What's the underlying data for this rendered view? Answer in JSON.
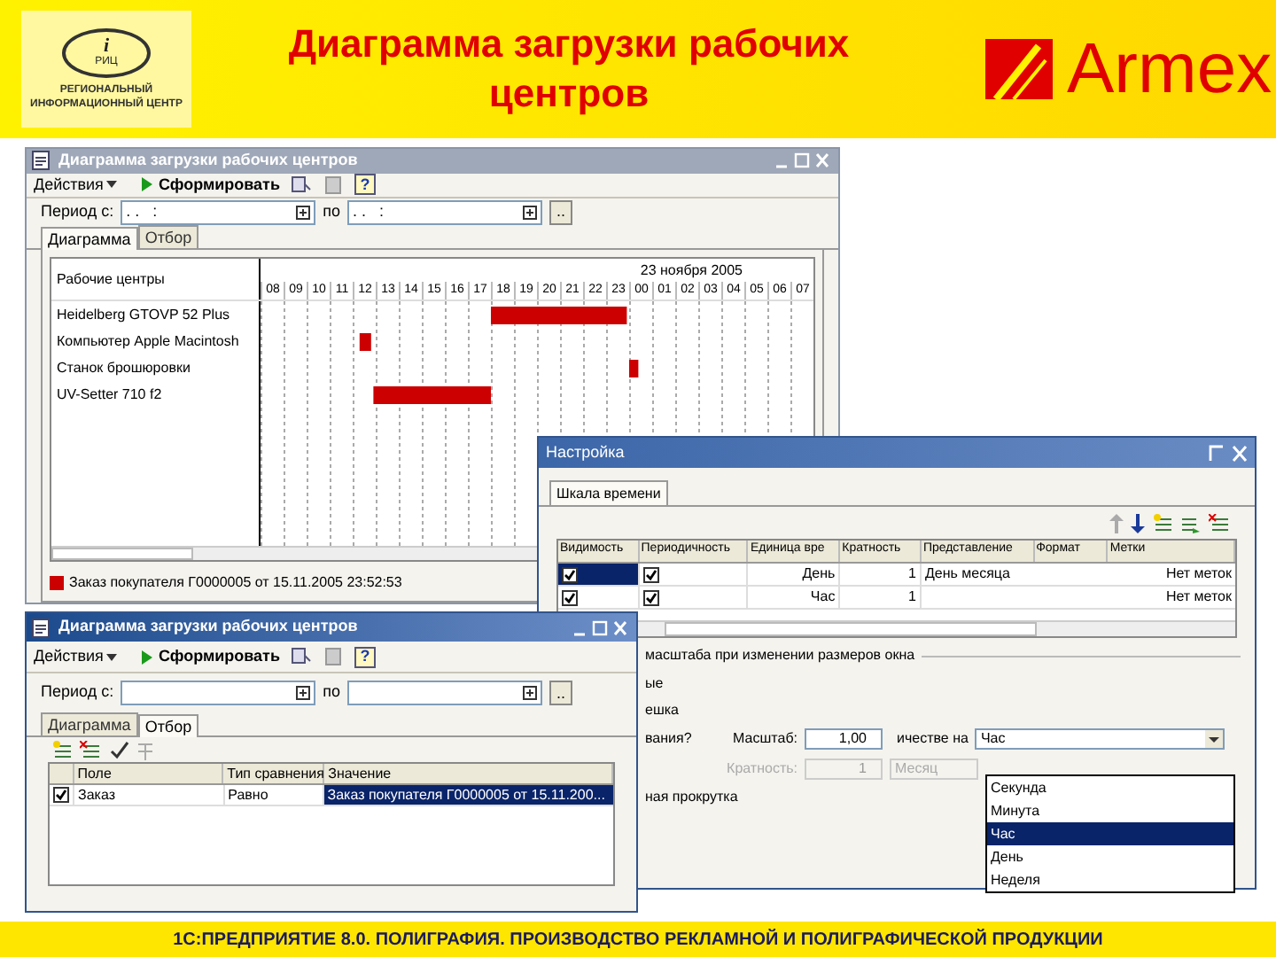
{
  "slide": {
    "logo": {
      "letter": "i",
      "abbr": "РИЦ",
      "caption": "РЕГИОНАЛЬНЫЙ ИНФОРМАЦИОННЫЙ ЦЕНТР"
    },
    "title": "Диаграмма загрузки рабочих центров",
    "brand": "Armex",
    "footer": "1С:ПРЕДПРИЯТИЕ 8.0. ПОЛИГРАФИЯ. ПРОИЗВОДСТВО РЕКЛАМНОЙ И ПОЛИГРАФИЧЕСКОЙ ПРОДУКЦИИ"
  },
  "report_window": {
    "title": "Диаграмма загрузки рабочих центров",
    "actions": "Действия",
    "generate": "Сформировать",
    "help": "?",
    "period_label": "Период с:",
    "period_from": ". .   :",
    "to_label": "по",
    "period_to": ". .   :",
    "more": "..",
    "tabs": [
      {
        "label": "Диаграмма",
        "selected": true
      },
      {
        "label": "Отбор",
        "selected": false
      }
    ],
    "gantt": {
      "header": "Рабочие центры",
      "date": "23 ноября 2005",
      "work_centers": [
        "Heidelberg GTOVP 52 Plus",
        "Компьютер Apple Macintosh",
        "Станок брошюровки",
        "UV-Setter 710 f2"
      ],
      "hours": [
        "08",
        "09",
        "10",
        "11",
        "12",
        "13",
        "14",
        "15",
        "16",
        "17",
        "18",
        "19",
        "20",
        "21",
        "22",
        "23",
        "00",
        "01",
        "02",
        "03",
        "04",
        "05",
        "06",
        "07"
      ],
      "legend": "Заказ покупателя Г0000005 от 15.11.2005 23:52:53"
    }
  },
  "settings_window": {
    "title": "Настройка",
    "tab": "Шкала времени",
    "columns": [
      "Видимость",
      "Периодичность",
      "Единица вре",
      "Кратность",
      "Представление",
      "Формат",
      "Метки"
    ],
    "rows": [
      {
        "visible": true,
        "periodic": true,
        "unit": "День",
        "multiplicity": "1",
        "presentation": "День месяца",
        "marks": "Нет меток",
        "selected": true
      },
      {
        "visible": true,
        "periodic": true,
        "unit": "Час",
        "multiplicity": "1",
        "presentation": "",
        "marks": "Нет меток",
        "selected": false
      }
    ],
    "group_title": "масштаба при изменении размеров окна",
    "line_1": "ые",
    "line_2": "ешка",
    "line_3": "вания?",
    "scale_label": "Масштаб:",
    "scale_value": "1,00",
    "unit_label": "ичестве на",
    "unit_value": "Час",
    "multiplicity_label": "Кратность:",
    "multiplicity_value": "1",
    "multiplicity_unit": "Месяц",
    "scroll_label": "ная прокрутка",
    "dropdown": [
      {
        "label": "Секунда",
        "selected": false
      },
      {
        "label": "Минута",
        "selected": false
      },
      {
        "label": "Час",
        "selected": true
      },
      {
        "label": "День",
        "selected": false
      },
      {
        "label": "Неделя",
        "selected": false
      }
    ]
  },
  "filter_window": {
    "title": "Диаграмма загрузки рабочих центров",
    "actions": "Действия",
    "generate": "Сформировать",
    "help": "?",
    "period_label": "Период с:",
    "to_label": "по",
    "more": "..",
    "tabs": [
      {
        "label": "Диаграмма",
        "selected": false
      },
      {
        "label": "Отбор",
        "selected": true
      }
    ],
    "columns": [
      "Поле",
      "Тип сравнения",
      "Значение"
    ],
    "rows": [
      {
        "checked": true,
        "field": "Заказ",
        "comparison": "Равно",
        "value": "Заказ покупателя Г0000005 от 15.11.200...",
        "selected": true
      }
    ]
  }
}
